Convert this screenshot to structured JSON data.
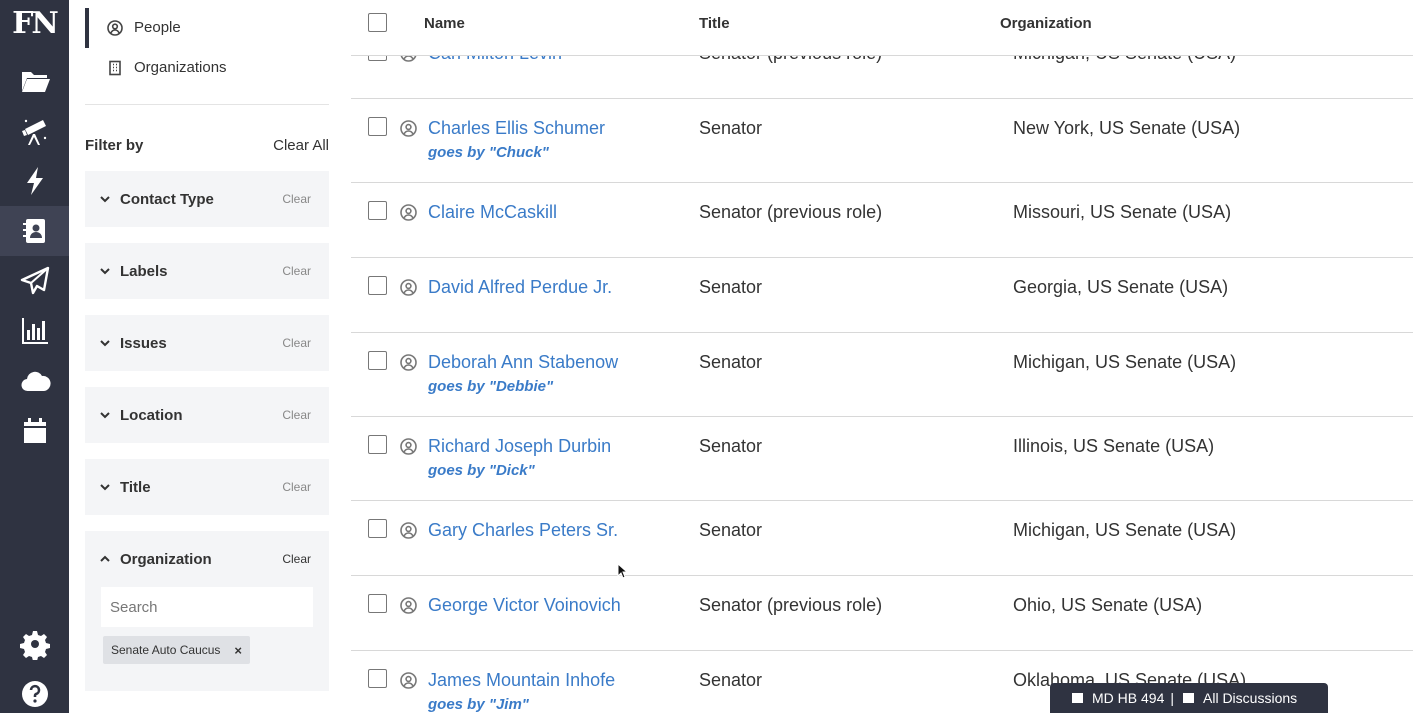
{
  "rail": {
    "logo": "FN",
    "items": [
      "folder-icon",
      "telescope-icon",
      "bolt-icon",
      "contacts-icon",
      "send-icon",
      "chart-icon",
      "cloud-icon",
      "calendar-icon",
      "gear-icon",
      "help-icon"
    ],
    "active": "contacts-icon"
  },
  "nav": {
    "people": "People",
    "organizations": "Organizations"
  },
  "filters": {
    "heading": "Filter by",
    "clear_all": "Clear All",
    "clear_label": "Clear",
    "sections": [
      "Contact Type",
      "Labels",
      "Issues",
      "Location",
      "Title",
      "Organization"
    ],
    "organization": {
      "search_placeholder": "Search",
      "chip": "Senate Auto Caucus",
      "chip_remove": "×"
    }
  },
  "table": {
    "headers": {
      "name": "Name",
      "title": "Title",
      "organization": "Organization"
    },
    "rows": [
      {
        "name": "Carl Milton Levin",
        "goes_by": "",
        "title": "Senator (previous role)",
        "organization": "Michigan, US Senate (USA)"
      },
      {
        "name": "Charles Ellis Schumer",
        "goes_by": "goes by \"Chuck\"",
        "title": "Senator",
        "organization": "New York, US Senate (USA)"
      },
      {
        "name": "Claire McCaskill",
        "goes_by": "",
        "title": "Senator (previous role)",
        "organization": "Missouri, US Senate (USA)"
      },
      {
        "name": "David Alfred Perdue Jr.",
        "goes_by": "",
        "title": "Senator",
        "organization": "Georgia, US Senate (USA)"
      },
      {
        "name": "Deborah Ann Stabenow",
        "goes_by": "goes by \"Debbie\"",
        "title": "Senator",
        "organization": "Michigan, US Senate (USA)"
      },
      {
        "name": "Richard Joseph Durbin",
        "goes_by": "goes by \"Dick\"",
        "title": "Senator",
        "organization": "Illinois, US Senate (USA)"
      },
      {
        "name": "Gary Charles Peters Sr.",
        "goes_by": "",
        "title": "Senator",
        "organization": "Michigan, US Senate (USA)"
      },
      {
        "name": "George Victor Voinovich",
        "goes_by": "",
        "title": "Senator (previous role)",
        "organization": "Ohio, US Senate (USA)"
      },
      {
        "name": "James Mountain Inhofe",
        "goes_by": "goes by \"Jim\"",
        "title": "Senator",
        "organization": "Oklahoma, US Senate (USA)"
      }
    ]
  },
  "discussions": {
    "bill": "MD HB 494",
    "separator": "|",
    "all": "All Discussions"
  }
}
